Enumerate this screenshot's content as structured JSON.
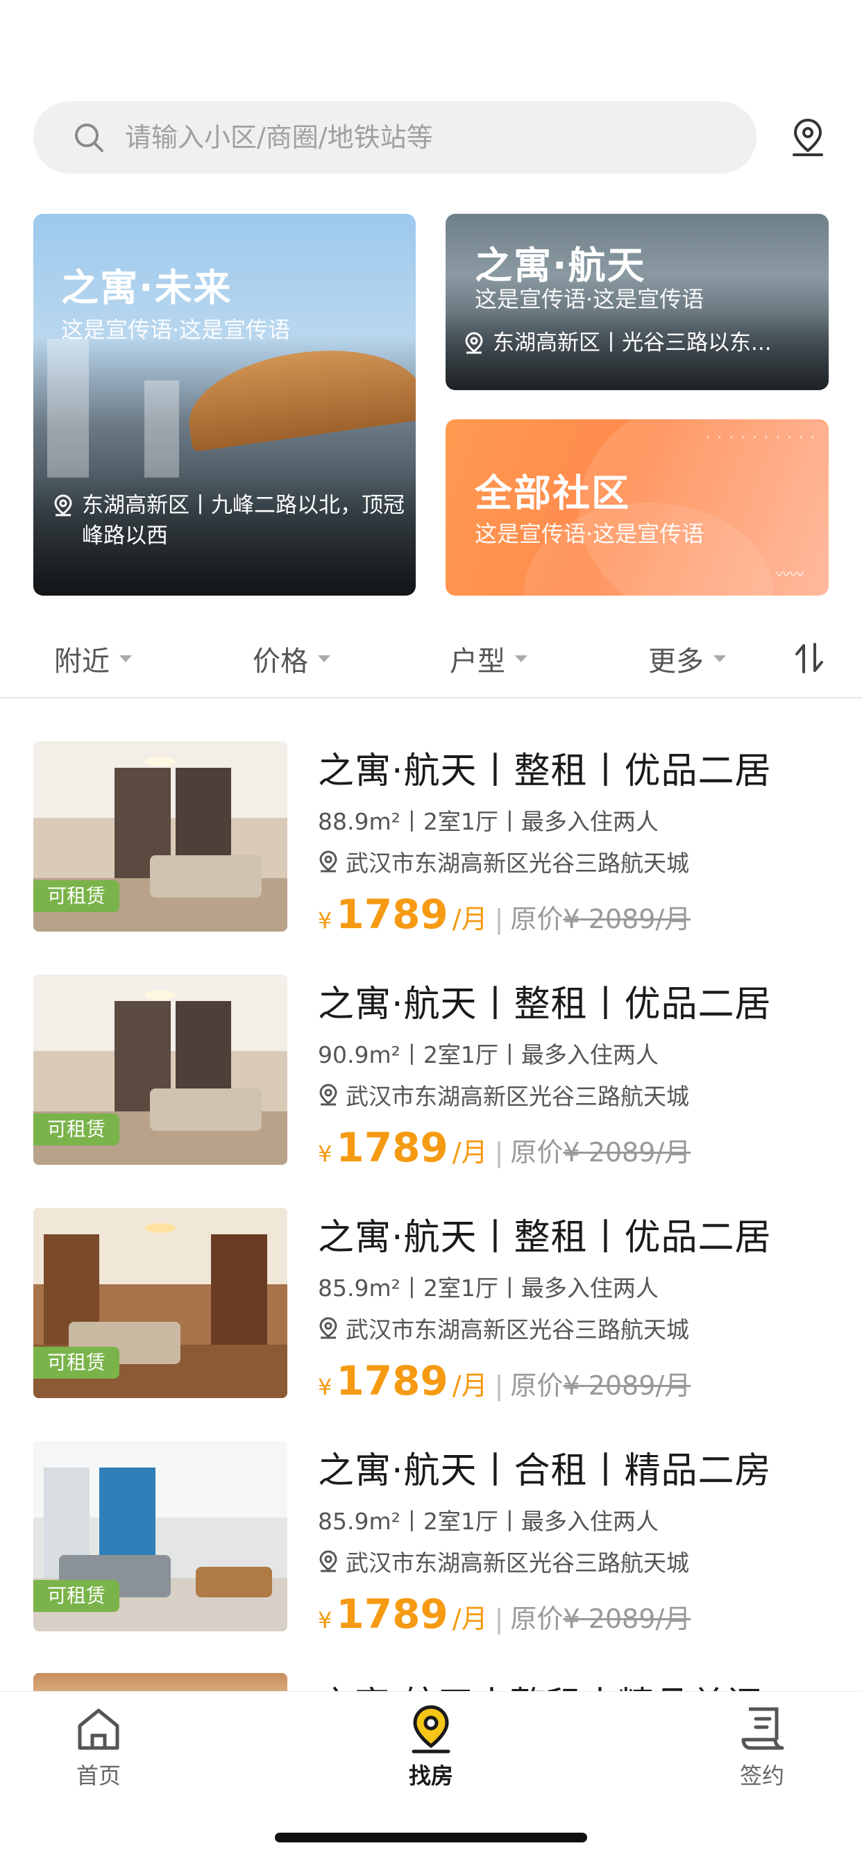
{
  "search": {
    "placeholder": "请输入小区/商圈/地铁站等"
  },
  "banners": {
    "big": {
      "title": "之寓·未来",
      "slogan": "这是宣传语·这是宣传语",
      "address": "东湖高新区丨九峰二路以北，顶冠峰路以西"
    },
    "small1": {
      "title": "之寓·航天",
      "slogan": "这是宣传语·这是宣传语",
      "address": "东湖高新区丨光谷三路以东..."
    },
    "small2": {
      "title": "全部社区",
      "slogan": "这是宣传语·这是宣传语"
    }
  },
  "filters": {
    "nearby": "附近",
    "price": "价格",
    "layout": "户型",
    "more": "更多"
  },
  "listings": [
    {
      "title": "之寓·航天丨整租丨优品二居",
      "meta": "88.9m²丨2室1厅丨最多入住两人",
      "address": "武汉市东湖高新区光谷三路航天城",
      "badge": "可租赁",
      "yen": "¥",
      "price": "1789",
      "unit": "/月",
      "orig_label": "原价",
      "orig_price": "¥ 2089/月"
    },
    {
      "title": "之寓·航天丨整租丨优品二居",
      "meta": "90.9m²丨2室1厅丨最多入住两人",
      "address": "武汉市东湖高新区光谷三路航天城",
      "badge": "可租赁",
      "yen": "¥",
      "price": "1789",
      "unit": "/月",
      "orig_label": "原价",
      "orig_price": "¥ 2089/月"
    },
    {
      "title": "之寓·航天丨整租丨优品二居",
      "meta": "85.9m²丨2室1厅丨最多入住两人",
      "address": "武汉市东湖高新区光谷三路航天城",
      "badge": "可租赁",
      "yen": "¥",
      "price": "1789",
      "unit": "/月",
      "orig_label": "原价",
      "orig_price": "¥ 2089/月"
    },
    {
      "title": "之寓·航天丨合租丨精品二房",
      "meta": "85.9m²丨2室1厅丨最多入住两人",
      "address": "武汉市东湖高新区光谷三路航天城",
      "badge": "可租赁",
      "yen": "¥",
      "price": "1789",
      "unit": "/月",
      "orig_label": "原价",
      "orig_price": "¥ 2089/月"
    }
  ],
  "peek": {
    "title": "之寓·航天丨整租丨精品单间"
  },
  "tabbar": {
    "home": "首页",
    "find": "找房",
    "sign": "签约"
  },
  "colors": {
    "accent": "#f59a12",
    "badge": "#7ab34a",
    "banner_orange": "#ff8a4d"
  }
}
